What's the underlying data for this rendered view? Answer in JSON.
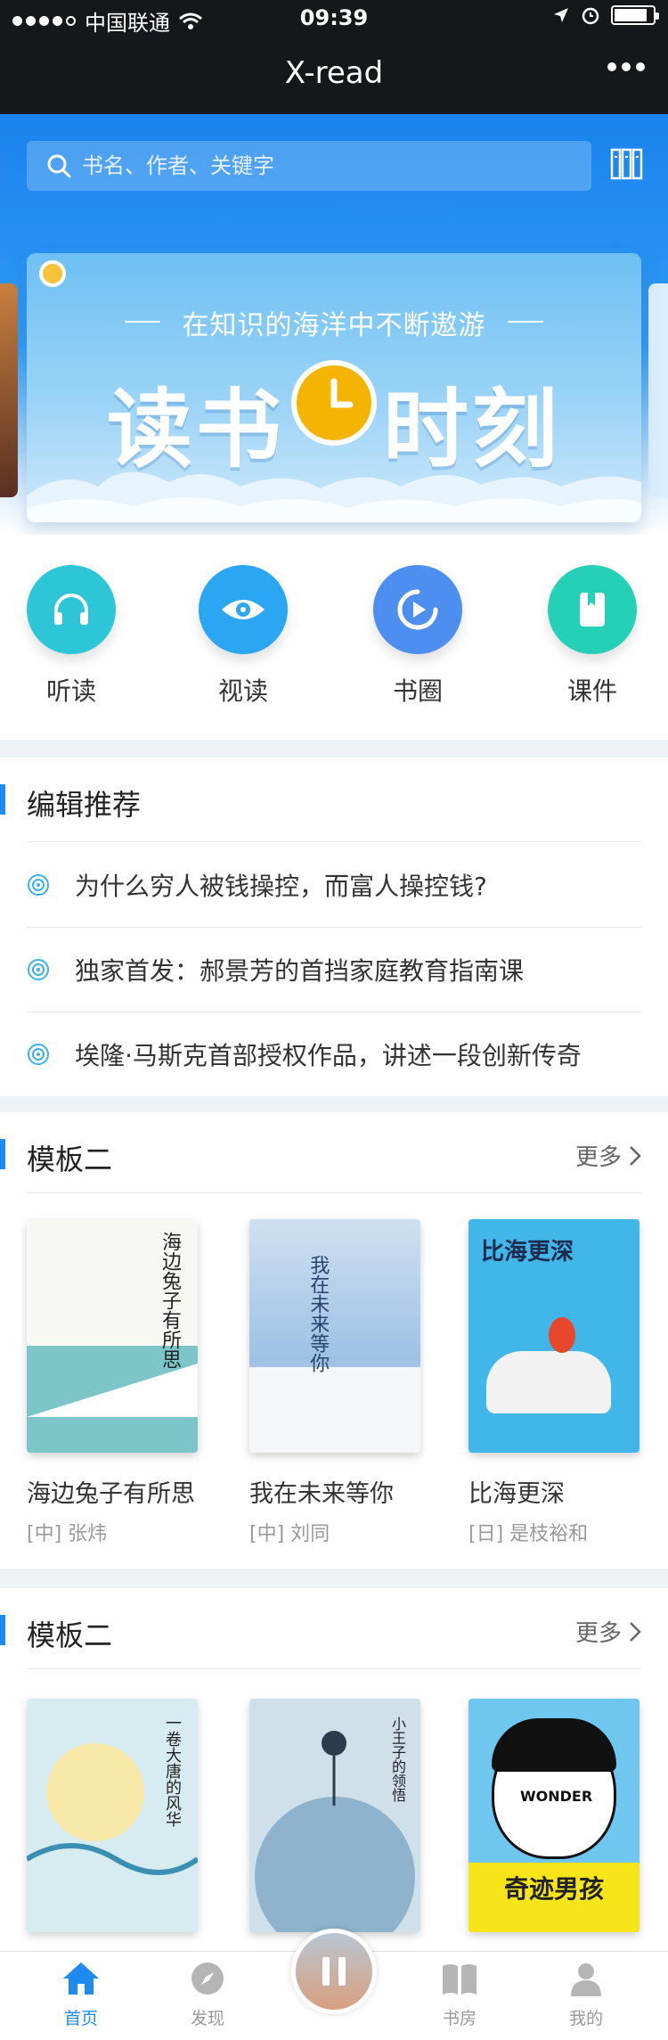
{
  "status": {
    "carrier": "中国联通",
    "time": "09:39",
    "battery_level": 0.85
  },
  "app": {
    "title": "X-read"
  },
  "search": {
    "placeholder": "书名、作者、关键字"
  },
  "banner": {
    "subtitle": "在知识的海洋中不断遨游",
    "headline_left": "读书",
    "headline_right": "时刻"
  },
  "quick_actions": [
    {
      "label": "听读",
      "icon": "headphones-icon",
      "color": "#2cc6d6"
    },
    {
      "label": "视读",
      "icon": "eye-icon",
      "color": "#2aa6f2"
    },
    {
      "label": "书圈",
      "icon": "play-circle-icon",
      "color": "#4d8ff0"
    },
    {
      "label": "课件",
      "icon": "bookmark-icon",
      "color": "#25d1b6"
    }
  ],
  "editor_picks": {
    "title": "编辑推荐",
    "items": [
      "为什么穷人被钱操控，而富人操控钱?",
      "独家首发：郝景芳的首挡家庭教育指南课",
      "埃隆·马斯克首部授权作品，讲述一段创新传奇"
    ]
  },
  "section1": {
    "title": "模板二",
    "more": "更多",
    "books": [
      {
        "title": "海边兔子有所思",
        "author": "[中] 张炜",
        "cover_text": "海边兔子有所思"
      },
      {
        "title": "我在未来等你",
        "author": "[中] 刘同",
        "cover_text": "我在未来等你"
      },
      {
        "title": "比海更深",
        "author": "[日] 是枝裕和",
        "cover_text": "比海更深"
      }
    ]
  },
  "section2": {
    "title": "模板二",
    "more": "更多",
    "books": [
      {
        "cover_text": "一卷大唐的风华"
      },
      {
        "cover_text": "小王子的领悟"
      },
      {
        "cover_text": "奇迹男孩",
        "cover_logo": "WONDER"
      }
    ]
  },
  "tabbar": {
    "items": [
      {
        "label": "首页",
        "icon": "home-icon",
        "active": true
      },
      {
        "label": "发现",
        "icon": "compass-icon",
        "active": false
      },
      {
        "label": "书房",
        "icon": "open-book-icon",
        "active": false
      },
      {
        "label": "我的",
        "icon": "user-icon",
        "active": false
      }
    ]
  },
  "colors": {
    "accent": "#1d8bf0",
    "nav_bg": "#15171b"
  }
}
